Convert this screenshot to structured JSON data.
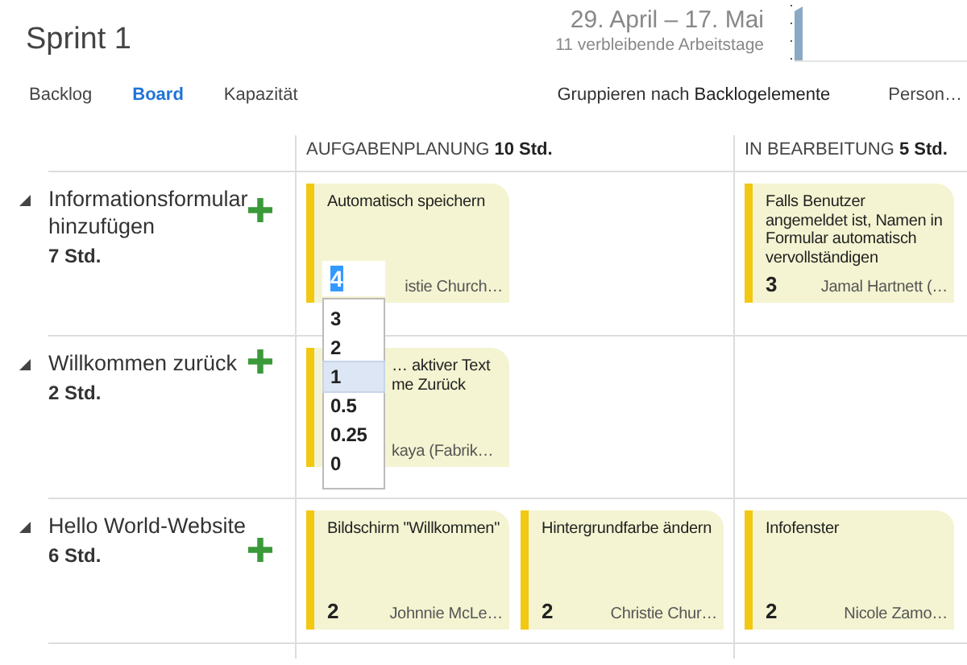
{
  "sprint": {
    "title": "Sprint 1",
    "dates": "29. April – 17. Mai",
    "remaining": "11 verbleibende Arbeitstage"
  },
  "tabs": [
    {
      "label": "Backlog",
      "selected": false
    },
    {
      "label": "Board",
      "selected": true
    },
    {
      "label": "Kapazität",
      "selected": false
    }
  ],
  "group_by": {
    "label": "Gruppieren nach",
    "value": "Backlogelemente"
  },
  "person_filter": "Person…",
  "columns": [
    {
      "name": "AUFGABENPLANUNG",
      "hours": "10 Std."
    },
    {
      "name": "IN BEARBEITUNG",
      "hours": "5 Std."
    }
  ],
  "rows": [
    {
      "title": "Informationsformular hinzufügen",
      "hours": "7 Std.",
      "expanded": true,
      "cells": [
        [
          {
            "title": "Automatisch speichern",
            "assigned": "istie Church…",
            "editor": {
              "value": "4",
              "options": [
                {
                  "label": "3",
                  "selected": false
                },
                {
                  "label": "2",
                  "selected": false
                },
                {
                  "label": "1",
                  "selected": true
                },
                {
                  "label": "0.5",
                  "selected": false
                },
                {
                  "label": "0.25",
                  "selected": false
                },
                {
                  "label": "0",
                  "selected": false
                }
              ]
            }
          }
        ],
        [
          {
            "title": "Falls Benutzer angemeldet ist, Namen in Formular automatisch vervollständigen",
            "hours": "3",
            "assigned": "Jamal Hartnett (…"
          }
        ]
      ]
    },
    {
      "title": "Willkommen zurück",
      "hours": "2 Std.",
      "expanded": true,
      "cells": [
        [
          {
            "title": "… aktiver Text me Zurück",
            "assigned": "kaya (Fabrik…",
            "covered": true
          }
        ],
        []
      ]
    },
    {
      "title": "Hello World-Website",
      "hours": "6 Std.",
      "expanded": true,
      "cells": [
        [
          {
            "title": "Bildschirm \"Willkommen\"",
            "hours": "2",
            "assigned": "Johnnie McLe…"
          },
          {
            "title": "Hintergrundfarbe ändern",
            "hours": "2",
            "assigned": "Christie Chur…"
          }
        ],
        [
          {
            "title": "Infofenster",
            "hours": "2",
            "assigned": "Nicole Zamo…"
          }
        ]
      ]
    }
  ]
}
